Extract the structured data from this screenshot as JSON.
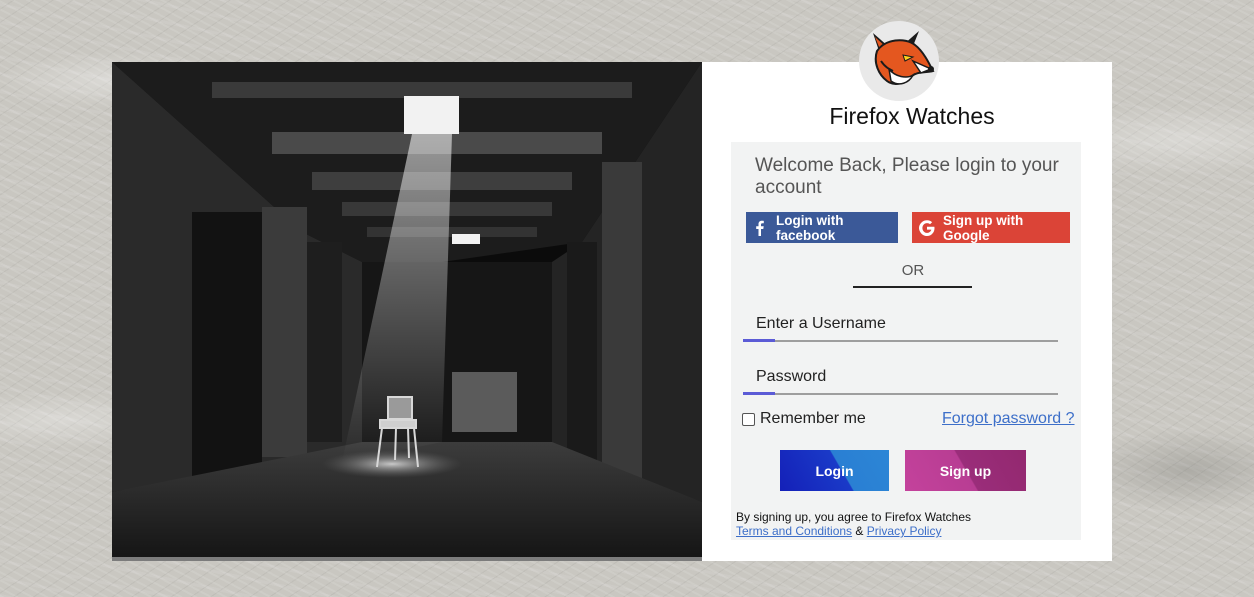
{
  "brand": {
    "name": "Firefox Watches",
    "logo_icon": "fox-head-icon"
  },
  "login_panel": {
    "welcome": "Welcome Back, Please login to your account",
    "facebook_button": {
      "label": "Login with facebook",
      "icon": "facebook-icon",
      "color": "#3b5998"
    },
    "google_button": {
      "label": "Sign up with Google",
      "icon": "google-icon",
      "color": "#db4437"
    },
    "divider_text": "OR",
    "username": {
      "placeholder": "Enter a Username",
      "value": ""
    },
    "password": {
      "placeholder": "Password",
      "value": ""
    },
    "remember_me": {
      "label": "Remember me",
      "checked": false
    },
    "forgot_password": "Forgot password ?",
    "login_button": "Login",
    "signup_button": "Sign up",
    "terms": {
      "prefix": "By signing up, you agree to Firefox Watches",
      "terms_link": "Terms and Conditions",
      "joiner": "&",
      "privacy_link": "Privacy Policy"
    }
  },
  "colors": {
    "accent_underline": "#5b5bd6",
    "link": "#3d6fc9",
    "login_gradient": [
      "#1420b8",
      "#2c86d6"
    ],
    "signup_gradient": [
      "#c4429c",
      "#93286f"
    ]
  }
}
